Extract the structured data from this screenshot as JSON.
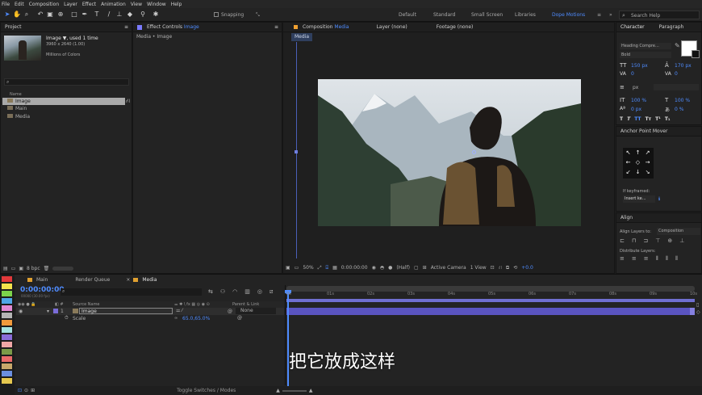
{
  "menubar": [
    "File",
    "Edit",
    "Composition",
    "Layer",
    "Effect",
    "Animation",
    "View",
    "Window",
    "Help"
  ],
  "toolbar": {
    "snapping_label": "Snapping",
    "workspaces": [
      "Default",
      "Standard",
      "Small Screen",
      "Libraries",
      "Dope Motions"
    ],
    "search_placeholder": "Search Help",
    "accent": "#4f8cff"
  },
  "project_panel": {
    "title": "Project",
    "item_name": "Image ▼, used 1 time",
    "item_dims": "3960 x 2640 (1.00)",
    "item_colors": "Millions of Colors",
    "search_placeholder": "",
    "column_header": "Name",
    "items": [
      "Image",
      "Main",
      "Media"
    ],
    "bpc_label": "8 bpc"
  },
  "effect_controls": {
    "title": "Effect Controls",
    "title_target": "Image",
    "breadcrumb": "Media • Image"
  },
  "composition_panel": {
    "tab_comp": "Composition",
    "tab_comp_target": "Media",
    "tab_layer": "Layer (none)",
    "tab_footage": "Footage (none)",
    "sub_tab": "Media",
    "zoom": "50%",
    "timecode": "0:00:00:00",
    "resolution": "(Half)",
    "camera": "Active Camera",
    "views": "1 View",
    "exposure": "+0.0"
  },
  "character_panel": {
    "tab_character": "Character",
    "tab_paragraph": "Paragraph",
    "font_name": "Heading Compre...",
    "font_style": "Bold",
    "font_size": "150 px",
    "leading": "170 px",
    "kerning": "0",
    "tracking": "0",
    "stroke_unit": "px",
    "vscale": "100 %",
    "hscale": "100 %",
    "baseline": "0 px",
    "tsume": "0 %"
  },
  "anchor_panel": {
    "title": "Anchor Point Mover",
    "if_keyframed_label": "If keyframed:",
    "if_keyframed_value": "Insert ke..."
  },
  "align_panel": {
    "title": "Align",
    "align_to_label": "Align Layers to:",
    "align_to_value": "Composition",
    "distribute_label": "Distribute Layers:"
  },
  "timeline": {
    "tabs": [
      "Main",
      "Render Queue",
      "Media"
    ],
    "current_time": "0:00:00:00",
    "fps_info": "00000 (30.00 fps)",
    "col_source": "Source Name",
    "col_parent": "Parent & Link",
    "layer_index": "1",
    "layer_name": "Image",
    "parent_value": "None",
    "property_name": "Scale",
    "property_value": "65.0,65.0%",
    "ruler": [
      "0s",
      "01s",
      "02s",
      "03s",
      "04s",
      "05s",
      "06s",
      "07s",
      "08s",
      "09s",
      "10s"
    ],
    "toggle_label": "Toggle Switches / Modes",
    "label_colors": [
      "#e2393b",
      "#f3e24b",
      "#7cd34b",
      "#4fa6e6",
      "#e389d2",
      "#b5b5b5",
      "#f09a3c",
      "#a4e3e0",
      "#8a6cd8",
      "#f0a7a7",
      "#7a9a48",
      "#e96a6a",
      "#c8a86b",
      "#6b8fe0",
      "#e6c84f"
    ]
  },
  "subtitle": "把它放成这样"
}
